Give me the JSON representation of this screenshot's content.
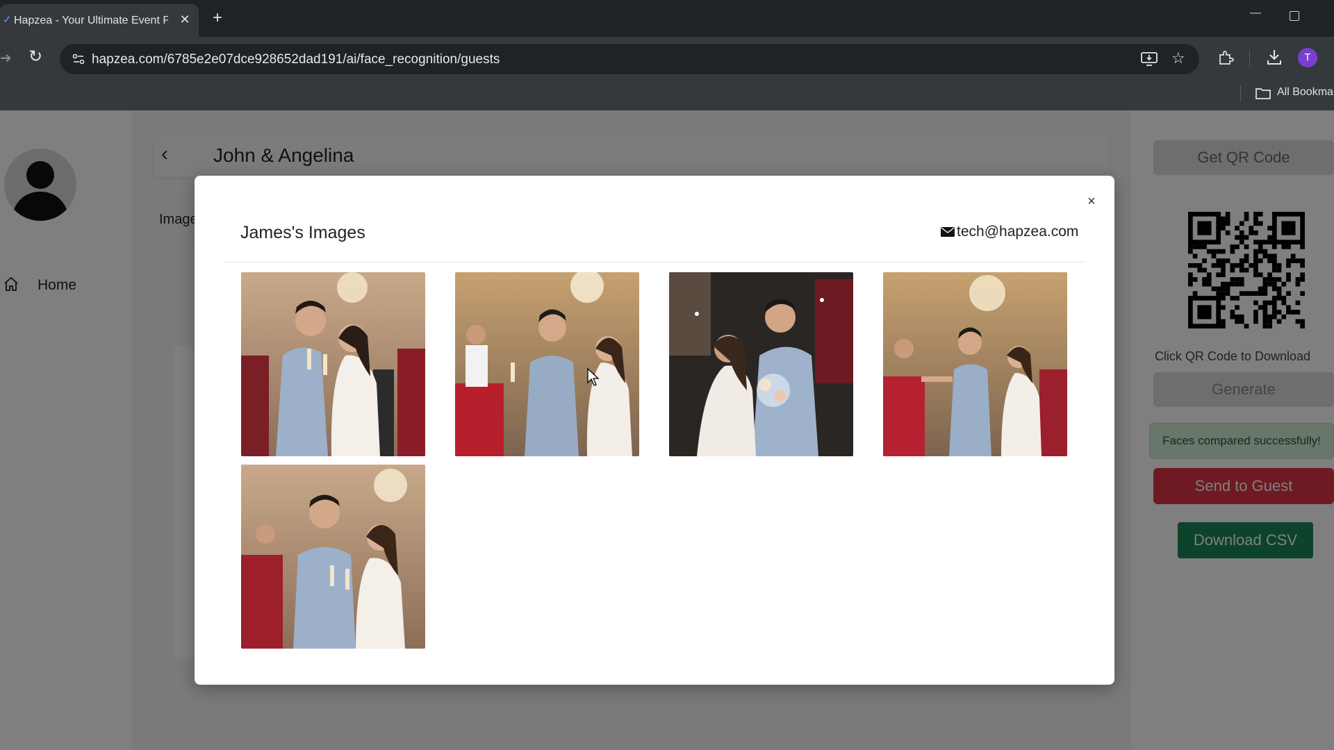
{
  "browser": {
    "tab_title": "Hapzea - Your Ultimate Event P",
    "tab_close": "✕",
    "new_tab": "+",
    "url": "hapzea.com/6785e2e07dce928652dad191/ai/face_recognition/guests",
    "bookmarks_label": "All Bookma",
    "profile_initial": "T"
  },
  "sidebar": {
    "home_label": "Home"
  },
  "event": {
    "title": "John & Angelina",
    "images_tab": "Image"
  },
  "right_panel": {
    "get_qr_label": "Get QR Code",
    "qr_caption": "Click QR Code to Download",
    "generate_label": "Generate",
    "success_message": "Faces compared successfully!",
    "send_label": "Send to Guest",
    "download_csv_label": "Download CSV"
  },
  "modal": {
    "title": "James's Images",
    "email": "tech@hapzea.com",
    "close": "×",
    "photos": [
      {
        "scene": "couple-toast-kiss"
      },
      {
        "scene": "group-toast"
      },
      {
        "scene": "sparkler-kiss"
      },
      {
        "scene": "group-toast-wide"
      },
      {
        "scene": "couple-toast-smile"
      }
    ]
  },
  "colors": {
    "accent_red": "#dc3545",
    "accent_green": "#198754",
    "success_bg": "#d1ecd8",
    "chrome_dark": "#1f2326"
  }
}
